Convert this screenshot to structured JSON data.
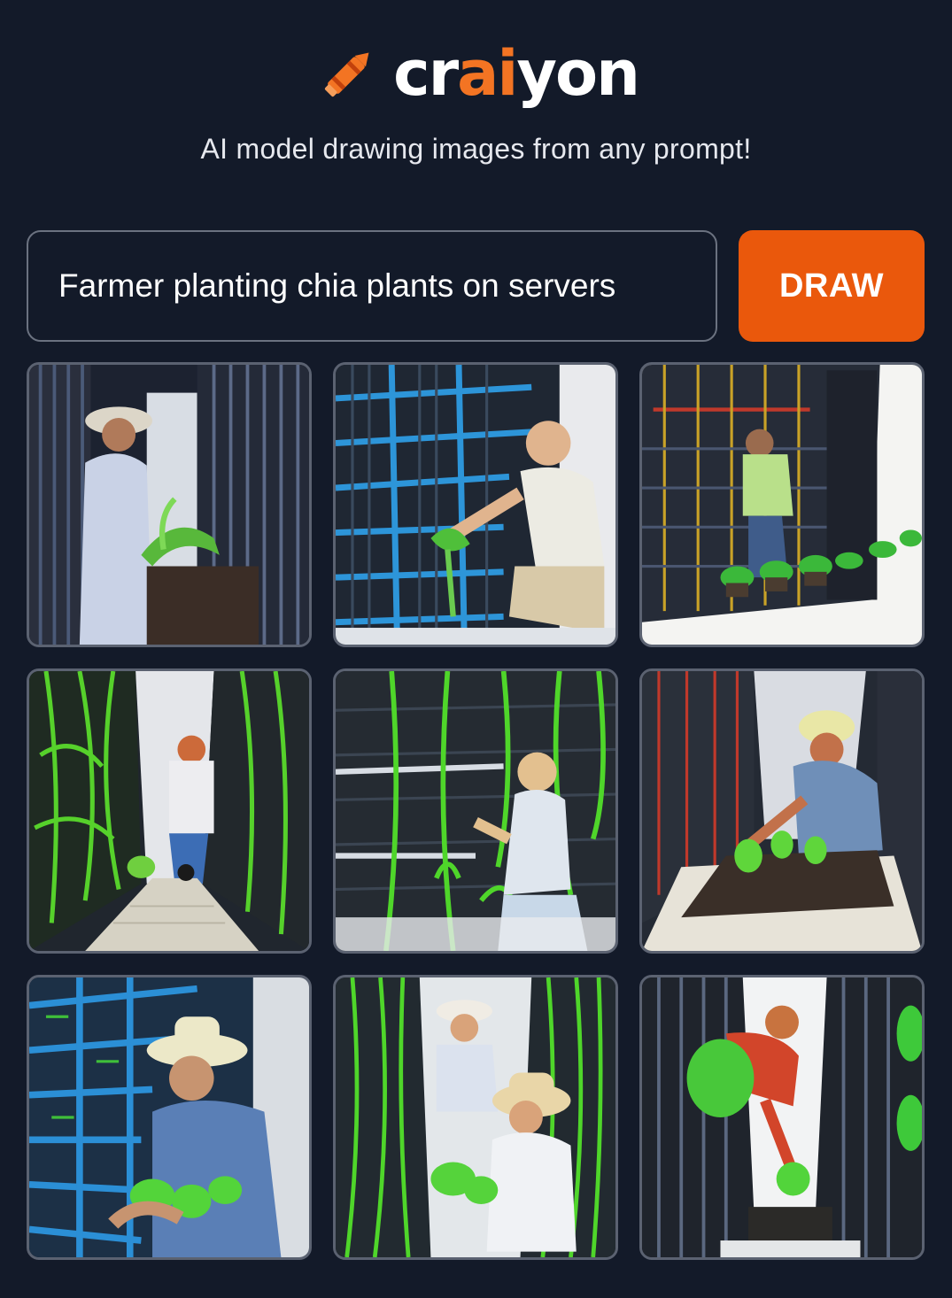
{
  "app": {
    "logo_prefix": "cr",
    "logo_accent": "ai",
    "logo_suffix": "yon",
    "tagline": "AI model drawing images from any prompt!",
    "brand_color": "#ea580c",
    "background_color": "#131a29"
  },
  "prompt": {
    "value": "Farmer planting chia plants on servers"
  },
  "draw_button": {
    "label": "DRAW"
  },
  "results": [
    {
      "theme": "farmer-in-white-with-potted-plant-between-server-racks"
    },
    {
      "theme": "farmer-kneeling-at-blue-server-rack"
    },
    {
      "theme": "farmer-at-server-wall-with-plant-row"
    },
    {
      "theme": "green-vines-on-server-corridor"
    },
    {
      "theme": "woman-tending-vines-on-server-racks"
    },
    {
      "theme": "farmer-in-hat-planting-in-soil-bed"
    },
    {
      "theme": "farmer-with-sun-hat-holding-lettuce"
    },
    {
      "theme": "two-farmers-in-hats-in-server-aisle"
    },
    {
      "theme": "farmer-in-red-with-green-sack-in-aisle"
    }
  ]
}
